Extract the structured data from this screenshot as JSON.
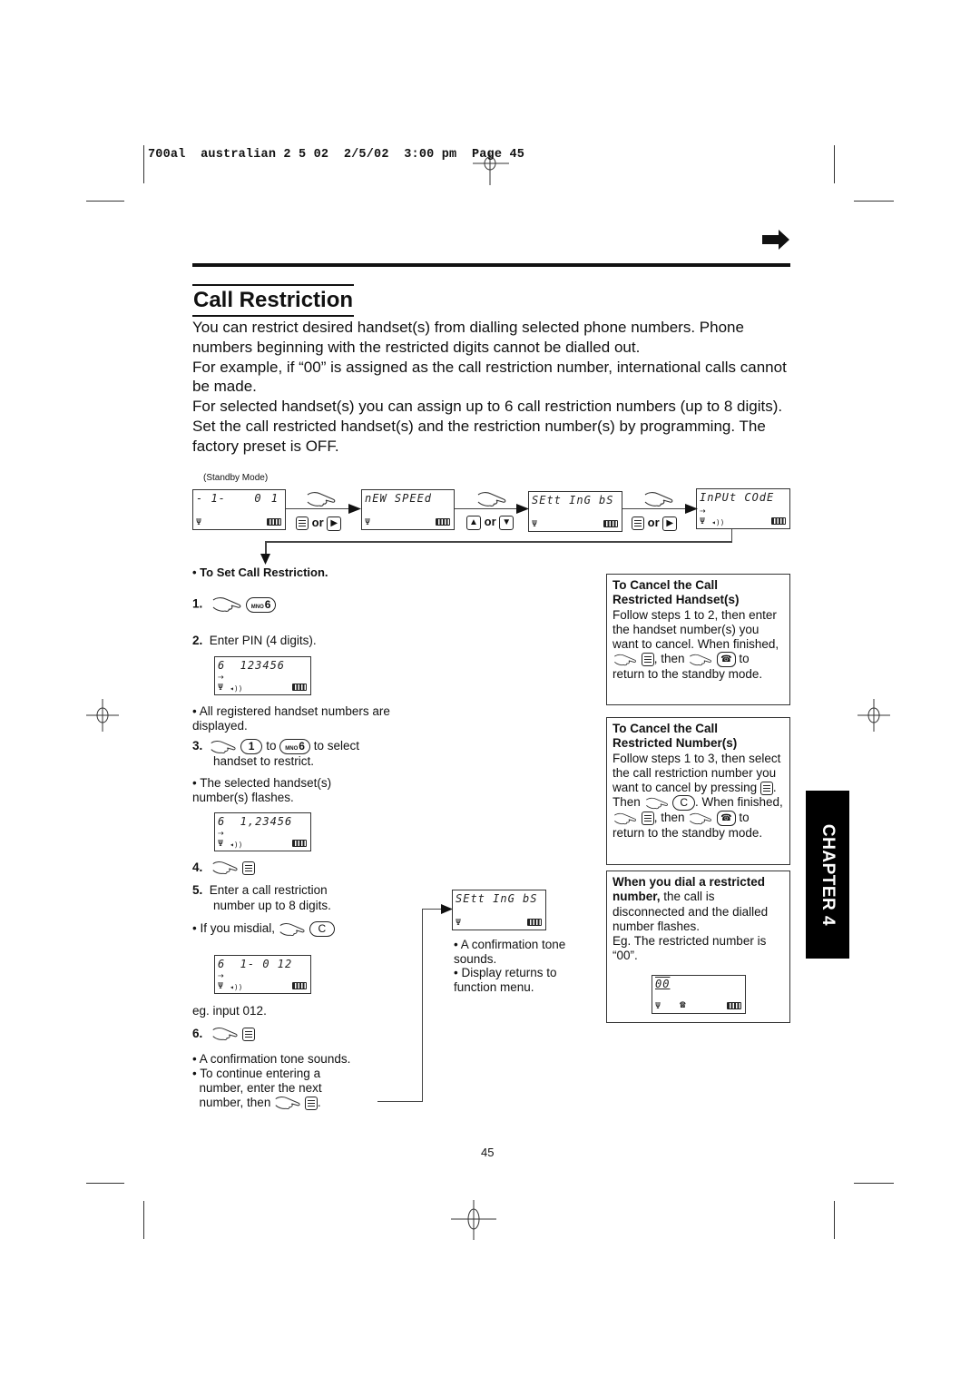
{
  "print_header": {
    "text": "700al  australian 2 5 02  2/5/02  3:00 pm  Page 45"
  },
  "page": {
    "title": "Call Restriction",
    "intro": [
      "You can restrict desired handset(s) from dialling selected phone numbers. Phone numbers beginning with the restricted digits cannot be dialled out.",
      "For example, if “00” is assigned as the call restriction number, international calls cannot be made.",
      "For selected handset(s) you can assign up to 6 call restriction numbers (up to 8 digits). Set the call restricted handset(s) and the restriction number(s) by programming. The factory preset is OFF."
    ],
    "page_number": "45",
    "chapter_tab": "CHAPTER 4",
    "next_page_icon": "arrow-right-icon"
  },
  "flow": {
    "standby_label": "(Standby Mode)",
    "screens": [
      {
        "left": "- 1-",
        "right": "0 1"
      },
      {
        "left": "nEW SPEEd",
        "right": ""
      },
      {
        "left": "SEtt InG bS",
        "right": ""
      },
      {
        "left": "InPUt COdE",
        "right": ""
      }
    ],
    "transitions": [
      {
        "icon_a": "menu-key-icon",
        "or": "or",
        "icon_b": "right-key-icon"
      },
      {
        "icon_a": "up-key-icon",
        "or": "or",
        "icon_b": "down-key-icon"
      },
      {
        "icon_a": "menu-key-icon",
        "or": "or",
        "icon_b": "right-key-icon"
      }
    ]
  },
  "procedure": {
    "heading": "To Set Call Restriction.",
    "steps": [
      {
        "num": "1.",
        "key_sub": "MNO",
        "key": "6"
      },
      {
        "num": "2.",
        "text": "Enter PIN (4 digits)."
      },
      {
        "num": "3.",
        "key1": "1",
        "to": "to",
        "key2_sub": "MNO",
        "key2": "6",
        "text_a": "to select",
        "text_b": "handset to restrict."
      },
      {
        "num": "4."
      },
      {
        "num": "5.",
        "text_a": "Enter a call restriction",
        "text_b": "number up to 8 digits."
      },
      {
        "num": "6."
      }
    ],
    "lcd_pin": "6  123456",
    "lcd_flash": "6  1,23456",
    "lcd_input": "6  1- 0 12",
    "note_registered": "All registered handset numbers are displayed.",
    "note_flashes": "The selected handset(s) number(s) flashes.",
    "misdial_text": "If you misdial,",
    "misdial_key": "C",
    "example": "eg. input 012.",
    "note_tone": "A confirmation tone sounds.",
    "note_continue_a": "To continue entering a",
    "note_continue_b": "number, enter the next",
    "note_continue_c": "number, then"
  },
  "result": {
    "lcd": "SEtt InG bS",
    "note_tone": "A confirmation tone sounds.",
    "note_return": "Display returns to function menu."
  },
  "boxes": {
    "cancel_handset": {
      "title_a": "To Cancel the Call",
      "title_b": "Restricted Handset(s)",
      "body_a": "Follow steps 1 to 2, then enter the handset number(s) you want to cancel. When finished,",
      "body_b": ", then",
      "body_c": "to return to the standby mode."
    },
    "cancel_number": {
      "title_a": "To Cancel the Call",
      "title_b": "Restricted Number(s)",
      "body_a": "Follow steps 1 to 3, then select the call restriction number you want to cancel by pressing",
      "body_b": ". Then",
      "key_c": "C",
      "body_c": ". When finished,",
      "body_d": ", then",
      "body_e": "to return to the standby mode."
    },
    "restricted_dial": {
      "title": "When you dial a restricted number,",
      "body": "the call is disconnected and the dialled number flashes.",
      "example": "Eg. The restricted number is “00”.",
      "lcd": "00"
    }
  }
}
